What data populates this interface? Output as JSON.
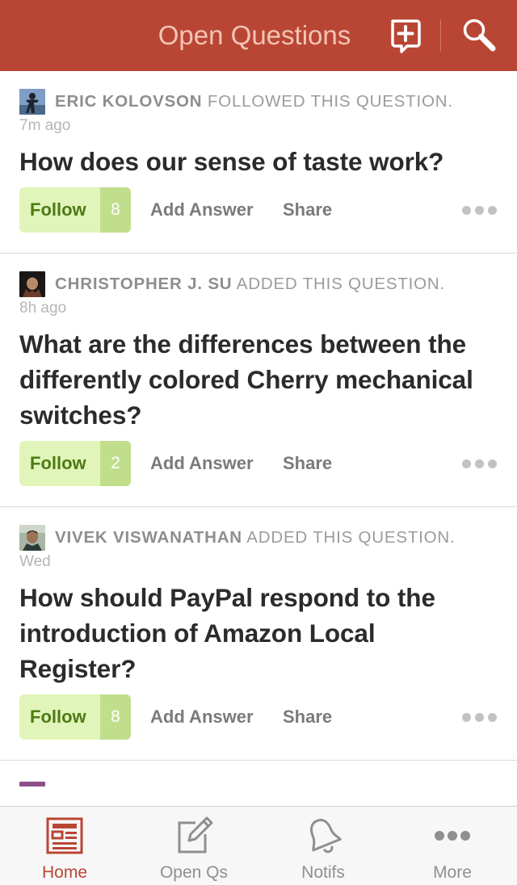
{
  "header": {
    "title": "Open Questions",
    "add_icon": "add-question-icon",
    "search_icon": "search-icon",
    "background_color": "#b94634"
  },
  "feed": {
    "items": [
      {
        "author": "ERIC KOLOVSON",
        "action": "FOLLOWED THIS QUESTION.",
        "time": "7m ago",
        "question": "How does our sense of taste work?",
        "follow_label": "Follow",
        "follow_count": "8",
        "answer_label": "Add Answer",
        "share_label": "Share",
        "more_icon": "more-dots-icon"
      },
      {
        "author": "CHRISTOPHER J. SU",
        "action": "ADDED THIS QUESTION.",
        "time": "8h ago",
        "question": "What are the differences between the differently colored Cherry mechanical switches?",
        "follow_label": "Follow",
        "follow_count": "2",
        "answer_label": "Add Answer",
        "share_label": "Share",
        "more_icon": "more-dots-icon"
      },
      {
        "author": "VIVEK VISWANATHAN",
        "action": "ADDED THIS QUESTION.",
        "time": "Wed",
        "question": "How should PayPal respond to the introduction of Amazon Local Register?",
        "follow_label": "Follow",
        "follow_count": "8",
        "answer_label": "Add Answer",
        "share_label": "Share",
        "more_icon": "more-dots-icon"
      }
    ]
  },
  "tabbar": {
    "tabs": [
      {
        "label": "Home",
        "icon": "home-feed-icon",
        "active": true
      },
      {
        "label": "Open Qs",
        "icon": "pencil-edit-icon",
        "active": false
      },
      {
        "label": "Notifs",
        "icon": "bell-icon",
        "active": false
      },
      {
        "label": "More",
        "icon": "more-dots-icon",
        "active": false
      }
    ],
    "active_color": "#b94634",
    "inactive_color": "#8f8f8f"
  },
  "colors": {
    "follow_bg": "#e1f4b9",
    "follow_text": "#4d7a15",
    "follow_count_bg": "#c1de8c"
  }
}
